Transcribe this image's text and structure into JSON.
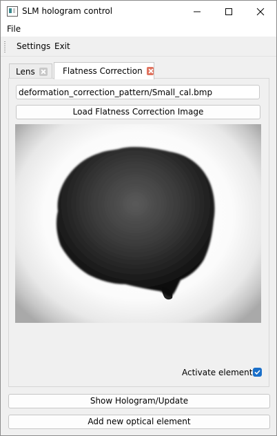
{
  "window": {
    "title": "SLM hologram control",
    "controls": [
      "minimize-icon",
      "maximize-icon",
      "close-icon"
    ]
  },
  "menubar": {
    "file": "File"
  },
  "toolbar": {
    "settings": "Settings",
    "exit": "Exit"
  },
  "tabs": [
    {
      "label": "Lens",
      "close_icon": "close-icon",
      "active": false
    },
    {
      "label": "Flatness Correction",
      "close_icon": "close-icon",
      "active": true
    }
  ],
  "flatness": {
    "path_value": "deformation_correction_pattern/Small_cal.bmp",
    "load_button": "Load Flatness Correction Image",
    "activate_label": "Activate element :",
    "activate_checked": true
  },
  "footer": {
    "show_button": "Show Hologram/Update",
    "add_button": "Add new optical element"
  },
  "colors": {
    "accent": "#1a6fc9",
    "active_tab_close": "#e0735f",
    "inactive_tab_close": "#c8c8c8"
  }
}
